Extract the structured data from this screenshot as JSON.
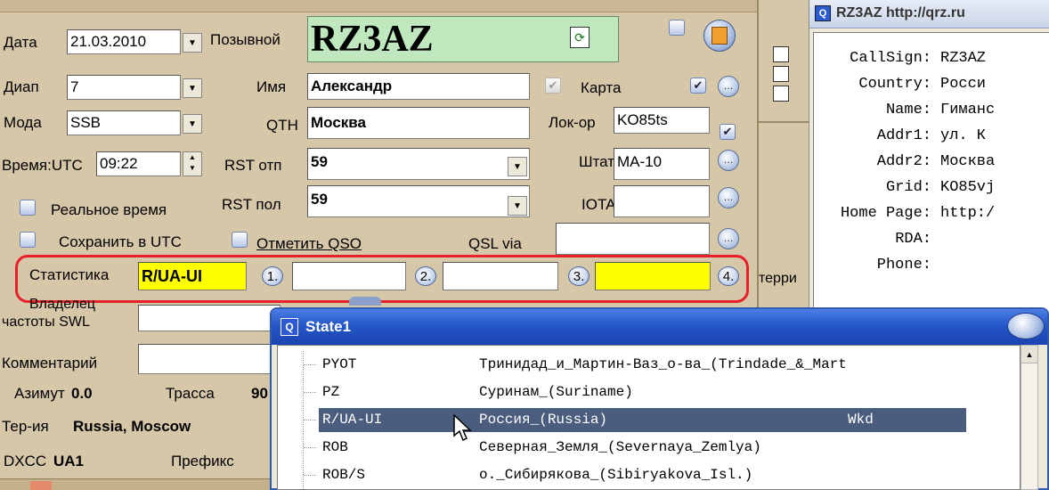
{
  "main": {
    "date_label": "Дата",
    "date_value": "21.03.2010",
    "callsign_label": "Позывной",
    "callsign_value": "RZ3AZ",
    "band_label": "Диап",
    "band_value": "7",
    "name_label": "Имя",
    "name_value": "Александр",
    "map_label": "Карта",
    "mode_label": "Мода",
    "mode_value": "SSB",
    "qth_label": "QTH",
    "qth_value": "Москва",
    "locator_label": "Лок-ор",
    "locator_value": "KO85ts",
    "time_label": "Время:UTC",
    "time_value": "09:22",
    "rst_sent_label": "RST отп",
    "rst_sent_value": "59",
    "state_label": "Штат",
    "state_value": "MA-10",
    "realtime_label": "Реальное время",
    "rst_rcvd_label": "RST пол",
    "rst_rcvd_value": "59",
    "iota_label": "IOTA",
    "save_utc_label": "Сохранить в UTC",
    "mark_qso_label": "Отметить QSO",
    "qsl_via_label": "QSL via",
    "stats_label": "Статистика",
    "stats_value": "R/UA-UI",
    "slot1": "1.",
    "slot2": "2.",
    "slot3": "3.",
    "slot4": "4.",
    "owner_label_1": "Владелец",
    "owner_label_2": "частоты SWL",
    "comment_label": "Комментарий",
    "azimuth_label": "Азимут",
    "azimuth_value": "0.0",
    "path_label": "Трасса",
    "path_value": "90",
    "territory_label": "Тер-ия",
    "territory_value": "Russia, Moscow",
    "dxcc_label": "DXCC",
    "dxcc_value": "UA1",
    "prefix_label": "Префикс",
    "side_text": "терри"
  },
  "qrz": {
    "title": "RZ3AZ http://qrz.ru",
    "lines": [
      {
        "key": "CallSign:",
        "value": "RZ3AZ"
      },
      {
        "key": "Country:",
        "value": "Росси"
      },
      {
        "key": "Name:",
        "value": "Гиманс"
      },
      {
        "key": "Addr1:",
        "value": "ул. К"
      },
      {
        "key": "Addr2:",
        "value": "Москва"
      },
      {
        "key": "Grid:",
        "value": "KO85vj"
      },
      {
        "key": "Home Page:",
        "value": "http:/"
      },
      {
        "key": "RDA:",
        "value": ""
      },
      {
        "key": "Phone:",
        "value": ""
      }
    ]
  },
  "state_window": {
    "title": "State1",
    "rows": [
      {
        "code": "PYOT",
        "name": "Тринидад_и_Мартин-Ваз_о-ва_(Trindade_&_Mart",
        "flag": ""
      },
      {
        "code": "PZ",
        "name": "Суринам_(Suriname)",
        "flag": ""
      },
      {
        "code": "R/UA-UI",
        "name": "Россия_(Russia)",
        "flag": "Wkd"
      },
      {
        "code": "ROB",
        "name": "Северная_Земля_(Severnaya_Zemlya)",
        "flag": ""
      },
      {
        "code": "ROB/S",
        "name": "о._Сибирякова_(Sibiryakova_Isl.)",
        "flag": ""
      }
    ]
  },
  "colors": {
    "panel": "#d6c7a8",
    "highlight_yellow": "#ffff00",
    "callsign_bg": "#bfe8bf",
    "selection": "#4a5d7e",
    "window_title": "#2d5ad0",
    "annotation_red": "#e8202a"
  }
}
